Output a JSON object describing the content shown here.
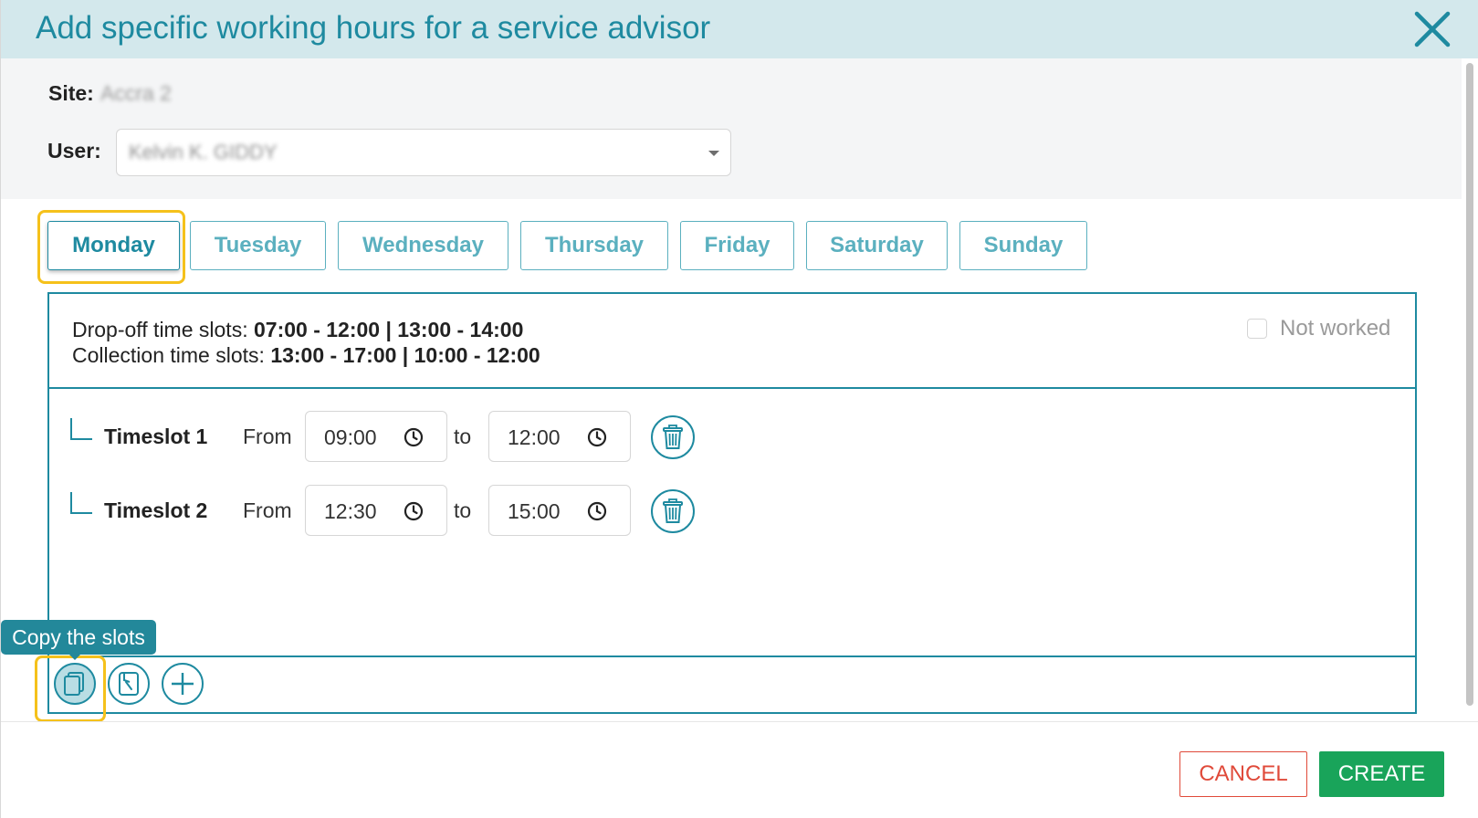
{
  "dialog": {
    "title": "Add specific working hours for a service advisor"
  },
  "site": {
    "label": "Site:",
    "value": "Accra 2"
  },
  "user": {
    "label": "User:",
    "value": "Kelvin K. GIDDY"
  },
  "days": [
    "Monday",
    "Tuesday",
    "Wednesday",
    "Thursday",
    "Friday",
    "Saturday",
    "Sunday"
  ],
  "active_day": "Monday",
  "summary": {
    "dropoff_label": "Drop-off time slots: ",
    "dropoff_value": "07:00 - 12:00 | 13:00 - 14:00",
    "collection_label": "Collection time slots: ",
    "collection_value": "13:00 - 17:00 | 10:00 - 12:00",
    "not_worked_label": "Not worked",
    "not_worked_checked": false
  },
  "timeslots": [
    {
      "label": "Timeslot 1",
      "from_label": "From",
      "from": "09:00",
      "to_label": "to",
      "to": "12:00"
    },
    {
      "label": "Timeslot 2",
      "from_label": "From",
      "from": "12:30",
      "to_label": "to",
      "to": "15:00"
    }
  ],
  "toolbar": {
    "tooltip": "Copy the slots",
    "icons": [
      "copy-slots-icon",
      "paste-slots-icon",
      "add-slot-icon"
    ]
  },
  "footer": {
    "cancel_label": "CANCEL",
    "create_label": "CREATE"
  },
  "colors": {
    "accent": "#1e8aa0",
    "header_bg": "#d3e8ec",
    "cancel": "#e04a3a",
    "create": "#19a45a",
    "highlight": "#f5c11b"
  }
}
